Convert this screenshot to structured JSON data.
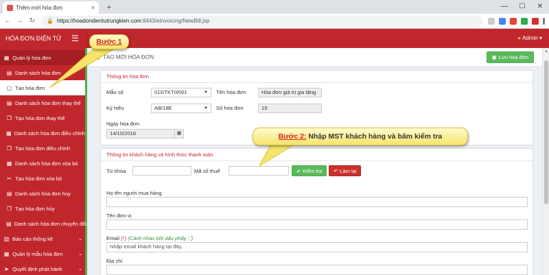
{
  "browser": {
    "tab_title": "Thêm mới hóa đơn",
    "tab_close": "×",
    "new_tab": "+",
    "min": "—",
    "max": "☐",
    "close": "✕",
    "url_host": "https://hoadondientutrungkien.com",
    "url_path": ":8443/eInvoicing/NewBill.jsp"
  },
  "header": {
    "brand": "HÓA ĐƠN ĐIỆN TỬ",
    "admin": "Admin"
  },
  "sidebar": {
    "items": [
      {
        "label": "Quản lý hóa đơn"
      },
      {
        "label": "Danh sách hóa đơn"
      },
      {
        "label": "Tạo hóa đơn"
      },
      {
        "label": "Danh sách hóa đơn thay thế"
      },
      {
        "label": "Tạo hóa đơn thay thế"
      },
      {
        "label": "Danh sách hóa đơn điều chỉnh"
      },
      {
        "label": "Tạo hóa đơn điều chỉnh"
      },
      {
        "label": "Danh sách hóa đơn xóa bỏ"
      },
      {
        "label": "Tạo hóa đơn xóa bỏ"
      },
      {
        "label": "Danh sách hóa đơn hủy"
      },
      {
        "label": "Tạo hóa đơn hủy"
      },
      {
        "label": "Danh sách hóa đơn chuyển đổi"
      },
      {
        "label": "Báo cáo thống kê"
      },
      {
        "label": "Quản lý mẫu hóa đơn"
      },
      {
        "label": "Quyết định phát hành"
      }
    ]
  },
  "page": {
    "title": "TẠO MỚI HÓA ĐƠN",
    "save_button": "Lưu hóa đơn"
  },
  "invoice_info": {
    "heading": "Thông tin hóa đơn",
    "mau_so_label": "Mẫu số",
    "mau_so_value": "01GTKT0/001",
    "ten_hd_label": "Tên hóa đơn",
    "ten_hd_value": "Hóa đơn giá trị gia tăng",
    "ky_hieu_label": "Ký hiệu",
    "ky_hieu_value": "AB/18E",
    "so_hd_label": "Số hóa đơn",
    "so_hd_value": "19",
    "ngay_label": "Ngày hóa đơn",
    "ngay_value": "14/10/2018"
  },
  "customer": {
    "heading": "Thông tin khách hàng và hình thức thanh toán",
    "tu_khoa_label": "Từ khóa",
    "mst_label": "Mã số thuế",
    "check_button": "Kiểm tra",
    "reset_button": "Làm lại",
    "buyer_label": "Họ tên người mua hàng",
    "unit_label": "Tên đơn vị",
    "email_label": "Email",
    "email_star": "(*)",
    "email_hint": "(Cách nhau bởi dấu phẩy ',')",
    "email_placeholder": "Nhập email khách hàng tại đây,",
    "address_label": "Địa chỉ"
  },
  "callouts": {
    "step1": "Bước 1",
    "step2_step": "Bước 2:",
    "step2_text": " Nhập MST khách hàng và bấm kiểm tra"
  }
}
